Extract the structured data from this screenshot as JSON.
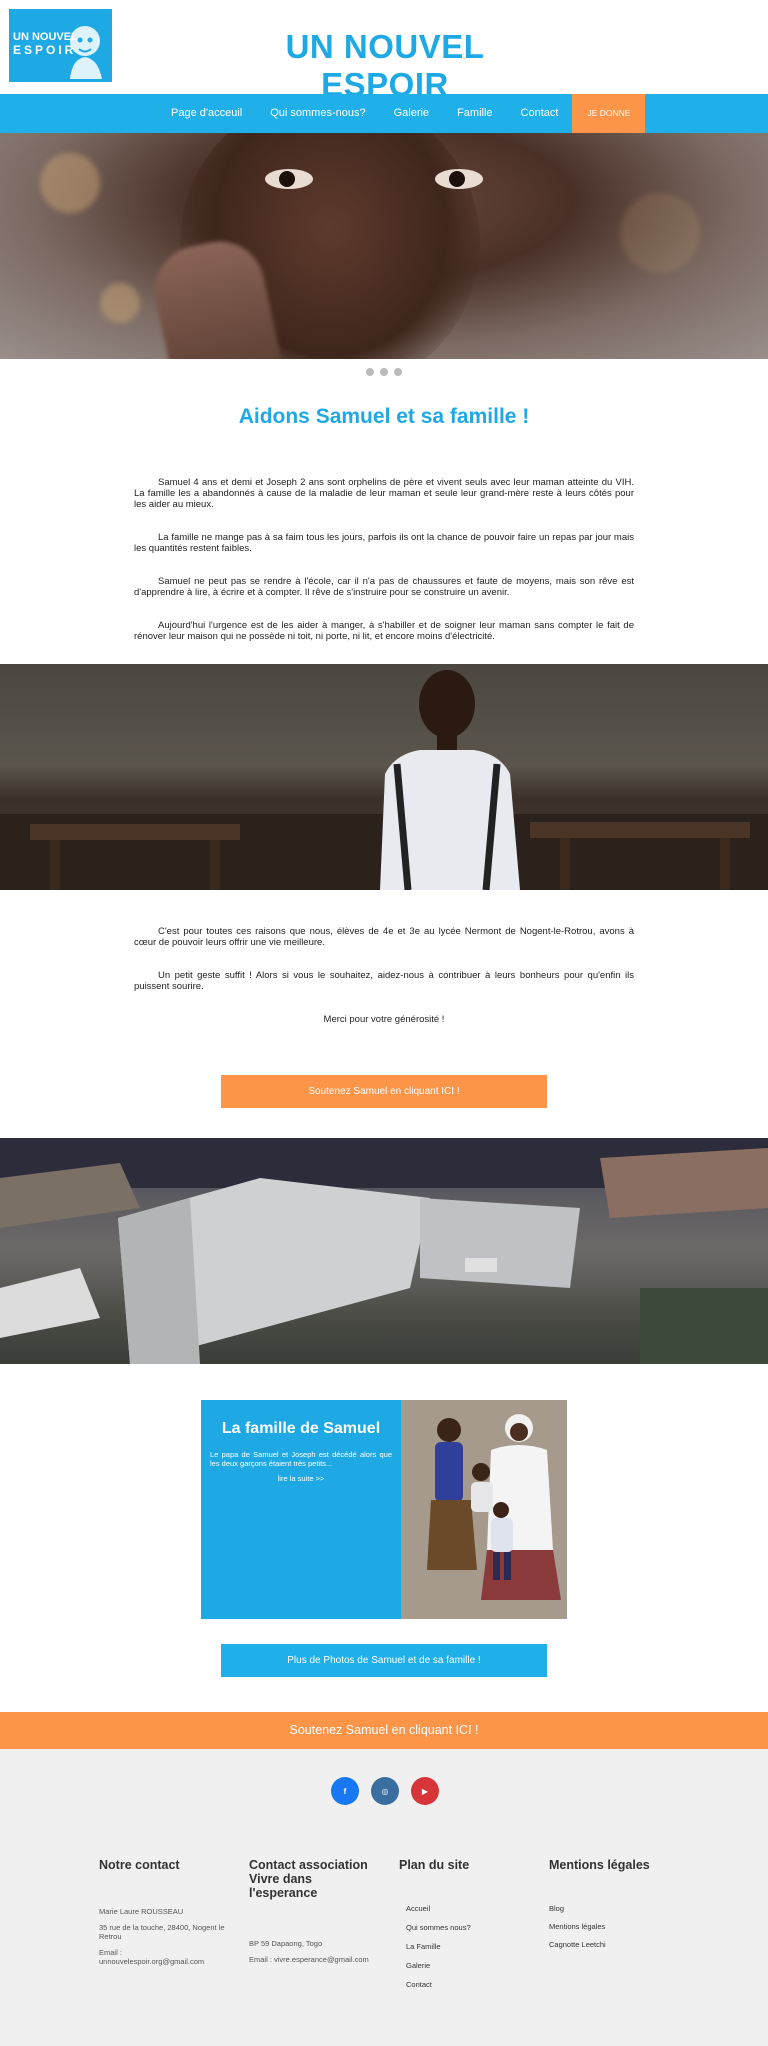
{
  "header": {
    "logo_line1": "UN NOUVEL",
    "logo_line2": "ESPOIR",
    "title": "UN NOUVEL ESPOIR"
  },
  "nav": {
    "items": [
      "Page d'acceuil",
      "Qui sommes-nous?",
      "Galerie",
      "Famille",
      "Contact"
    ],
    "donate": "JE DONNE"
  },
  "colors": {
    "accent_blue": "#1fa9e4",
    "accent_orange": "#fd9549",
    "footer_bg": "#f0f0f0"
  },
  "carousel": {
    "slide_count": 3,
    "active_slide": 1
  },
  "main": {
    "title": "Aidons Samuel et sa famille !",
    "paragraphs": [
      "Samuel 4 ans et demi et Joseph 2 ans sont orphelins de père et vivent seuls avec leur maman atteinte du VIH. La famille les a abandonnés à cause de la maladie de leur maman et seule leur grand-mère reste à leurs côtés pour les aider au mieux.",
      "La famille ne mange pas à sa faim tous les jours, parfois ils ont la chance de pouvoir faire un repas par jour mais les quantités restent faibles.",
      "Samuel ne peut pas se rendre à l'école, car il n'a pas de chaussures et faute de moyens, mais son rêve est d'apprendre à lire, à écrire et à compter. Il rêve de s'instruire pour se construire un avenir.",
      "Aujourd'hui l'urgence est de les aider à manger, à s'habiller et de soigner leur maman sans compter le fait de rénover leur maison qui ne possède ni toit, ni porte, ni lit, et encore moins d'électricité."
    ],
    "paragraphs2": [
      "C'est pour toutes ces raisons que nous, élèves de 4e et 3e au lycée Nermont de Nogent-le-Rotrou, avons à cœur de pouvoir leurs offrir une vie meilleure.",
      "Un petit geste suffit ! Alors si vous le souhaitez, aidez-nous à contribuer à leurs bonheurs pour qu'enfin ils puissent sourire."
    ],
    "thanks": "Merci pour votre générosité !",
    "support_button": "Soutenez Samuel en cliquant ICI !"
  },
  "famille": {
    "title": "La famille de Samuel",
    "text": "Le papa de Samuel et Joseph est décédé alors que les deux garçons étaient très petits...",
    "link": "lire la suite >>",
    "photos_button": "Plus de Photos de Samuel et de sa famille !"
  },
  "cta_bar": "Soutenez Samuel en cliquant ICI !",
  "footer": {
    "socials": [
      {
        "icon": "facebook-icon",
        "label": "f"
      },
      {
        "icon": "instagram-icon",
        "label": "◎"
      },
      {
        "icon": "youtube-icon",
        "label": "▶"
      }
    ],
    "contact": {
      "title": "Notre contact",
      "name": "Marie Laure ROUSSEAU",
      "address": "35 rue de la touche, 28400, Nogent le Retrou",
      "email": "Email : unnouvelespoir.org@gmail.com"
    },
    "association": {
      "title": "Contact association Vivre dans l'esperance",
      "address": "BP 59 Dapaong, Togo",
      "email": "Email : vivre.esperance@gmail.com"
    },
    "plan": {
      "title": "Plan du site",
      "links": [
        "Accueil",
        "Qui sommes nous?",
        "La Famille",
        "Galerie",
        "Contact"
      ]
    },
    "legal": {
      "title": "Mentions légales",
      "links": [
        "Blog",
        "Mentions légales",
        "Cagnotte Leetchi"
      ]
    }
  }
}
